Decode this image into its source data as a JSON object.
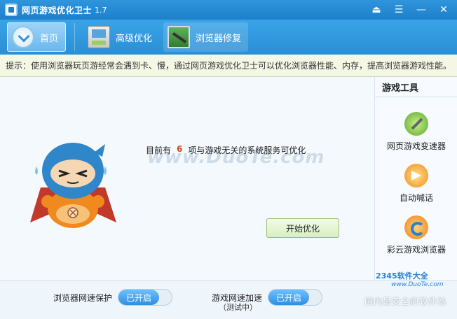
{
  "window": {
    "title": "网页游戏优化卫士",
    "version": "1.7",
    "buttons": [
      "minimize-to-tray",
      "menu",
      "minimize",
      "close"
    ]
  },
  "toolbar": {
    "items": [
      {
        "label": "首页",
        "icon": "home-icon",
        "active": true
      },
      {
        "label": "高级优化",
        "icon": "advanced-optimize-icon",
        "active": false
      },
      {
        "label": "浏览器修复",
        "icon": "browser-repair-icon",
        "active": false
      }
    ]
  },
  "tip": "提示：使用浏览器玩页游经常会遇到卡、慢，通过网页游戏优化卫士可以优化浏览器性能、内存，提高浏览器游戏性能。",
  "main": {
    "status_prefix": "目前有",
    "count": "6",
    "status_suffix": "项与游戏无关的系统服务可优化",
    "start_button": "开始优化",
    "watermark": "www.DuoTe.com"
  },
  "sidebar": {
    "title": "游戏工具",
    "items": [
      {
        "label": "网页游戏变速器",
        "icon": "speed-gear-icon"
      },
      {
        "label": "自动喊话",
        "icon": "auto-shout-icon"
      },
      {
        "label": "彩云游戏浏览器",
        "icon": "caiyun-browser-icon"
      }
    ]
  },
  "bottom": {
    "browser_protect_label": "浏览器网速保护",
    "browser_protect_state": "已开启",
    "game_speed_label": "游戏网速加速",
    "game_speed_state": "已开启",
    "game_speed_sub": "（测试中）"
  },
  "brand": {
    "name_top": "2345软件大全",
    "url": "www.DuoTe.com",
    "slogan": "国内最安全的软件站"
  },
  "colors": {
    "accent": "#2a8fd6",
    "count_color": "#d6451c",
    "toggle_on": "#2f8fe0"
  }
}
